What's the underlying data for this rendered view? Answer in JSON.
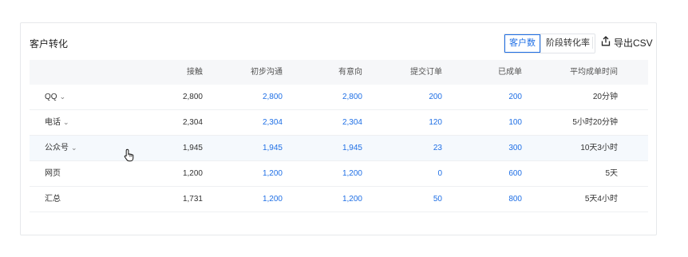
{
  "card": {
    "title": "客户转化",
    "segmented": [
      {
        "label": "客户数",
        "active": true
      },
      {
        "label": "阶段转化率",
        "active": false
      }
    ],
    "export_label": "导出CSV"
  },
  "table": {
    "headers": [
      "",
      "接触",
      "初步沟通",
      "有意向",
      "提交订单",
      "已成单",
      "平均成单时间"
    ],
    "rows": [
      {
        "channel": "QQ",
        "expandable": true,
        "contact": "2,800",
        "initial": "2,800",
        "intent": "2,800",
        "order": "200",
        "closed": "200",
        "avg_time": "20分钟"
      },
      {
        "channel": "电话",
        "expandable": true,
        "contact": "2,304",
        "initial": "2,304",
        "intent": "2,304",
        "order": "120",
        "closed": "100",
        "avg_time": "5小时20分钟"
      },
      {
        "channel": "公众号",
        "expandable": true,
        "contact": "1,945",
        "initial": "1,945",
        "intent": "1,945",
        "order": "23",
        "closed": "300",
        "avg_time": "10天3小时"
      },
      {
        "channel": "网页",
        "expandable": false,
        "contact": "1,200",
        "initial": "1,200",
        "intent": "1,200",
        "order": "0",
        "closed": "600",
        "avg_time": "5天"
      },
      {
        "channel": "汇总",
        "expandable": false,
        "contact": "1,731",
        "initial": "1,200",
        "intent": "1,200",
        "order": "50",
        "closed": "800",
        "avg_time": "5天4小时"
      }
    ],
    "hovered_row": 2
  },
  "icons": {
    "export": "export-upload-icon",
    "expand": "chevron-down-icon",
    "cursor": "hand-pointer-icon"
  },
  "colors": {
    "accent": "#1f6fe5",
    "header_bg": "#f6f7f9",
    "hover_bg": "#f5f9fd"
  }
}
